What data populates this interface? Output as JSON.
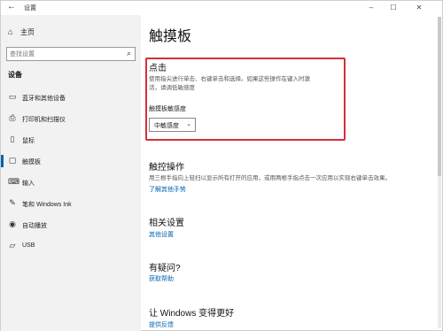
{
  "window": {
    "title": "设置",
    "back_icon": "arrow-left-icon",
    "controls": [
      "–",
      "☐",
      "✕"
    ]
  },
  "sidebar": {
    "home_label": "主页",
    "search_placeholder": "查找设置",
    "section_title": "设备",
    "items": [
      {
        "label": "蓝牙和其他设备",
        "icon": "bluetooth-icon",
        "active": false
      },
      {
        "label": "打印机和扫描仪",
        "icon": "printer-icon",
        "active": false
      },
      {
        "label": "鼠标",
        "icon": "mouse-icon",
        "active": false
      },
      {
        "label": "触摸板",
        "icon": "touchpad-icon",
        "active": true
      },
      {
        "label": "输入",
        "icon": "keyboard-icon",
        "active": false
      },
      {
        "label": "笔和 Windows Ink",
        "icon": "pen-icon",
        "active": false
      },
      {
        "label": "自动播放",
        "icon": "autoplay-icon",
        "active": false
      },
      {
        "label": "USB",
        "icon": "usb-icon",
        "active": false
      }
    ]
  },
  "main": {
    "page_title": "触摸板",
    "tap": {
      "heading": "点击",
      "description_line1": "使用指尖进行单击、右键单击和选择。如果这些操作在键入时激",
      "description_line2": "活，请调低敏感度",
      "sensitivity_label": "触摸板敏感度",
      "sensitivity_value": "中敏感度"
    },
    "gestures": {
      "heading": "触控操作",
      "description": "用三根手指向上轻扫以显示所有打开的应用，或用两根手指点击一次应用以实现右键单击效果。",
      "link": "了解其他手势"
    },
    "related": {
      "heading": "相关设置",
      "link": "其他设置"
    },
    "questions": {
      "heading": "有疑问?",
      "link": "获取帮助"
    },
    "improve": {
      "heading": "让 Windows 变得更好",
      "link": "提供反馈"
    }
  },
  "colors": {
    "accent": "#0063b1",
    "highlight_border": "#d32f3c",
    "sidebar_bg": "#f2f2f2"
  }
}
